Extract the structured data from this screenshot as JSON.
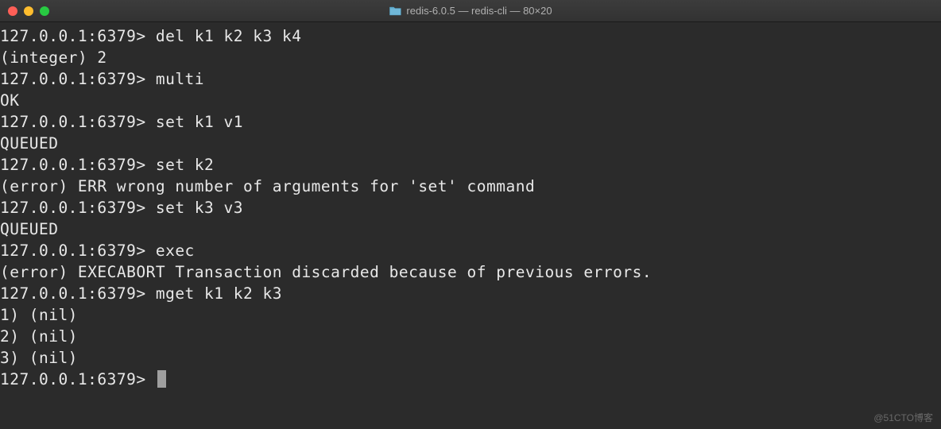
{
  "titlebar": {
    "title": "redis-6.0.5 — redis-cli — 80×20",
    "folder_icon": "folder-icon"
  },
  "prompt": "127.0.0.1:6379>",
  "session": [
    {
      "type": "cmd",
      "text": "del k1 k2 k3 k4"
    },
    {
      "type": "out",
      "text": "(integer) 2"
    },
    {
      "type": "cmd",
      "text": "multi"
    },
    {
      "type": "out",
      "text": "OK"
    },
    {
      "type": "cmd",
      "text": "set k1 v1"
    },
    {
      "type": "out",
      "text": "QUEUED"
    },
    {
      "type": "cmd",
      "text": "set k2"
    },
    {
      "type": "out",
      "text": "(error) ERR wrong number of arguments for 'set' command"
    },
    {
      "type": "cmd",
      "text": "set k3 v3"
    },
    {
      "type": "out",
      "text": "QUEUED"
    },
    {
      "type": "cmd",
      "text": "exec"
    },
    {
      "type": "out",
      "text": "(error) EXECABORT Transaction discarded because of previous errors."
    },
    {
      "type": "cmd",
      "text": "mget k1 k2 k3"
    },
    {
      "type": "out",
      "text": "1) (nil)"
    },
    {
      "type": "out",
      "text": "2) (nil)"
    },
    {
      "type": "out",
      "text": "3) (nil)"
    },
    {
      "type": "cmd",
      "text": "",
      "cursor": true
    }
  ],
  "watermark": "@51CTO博客"
}
